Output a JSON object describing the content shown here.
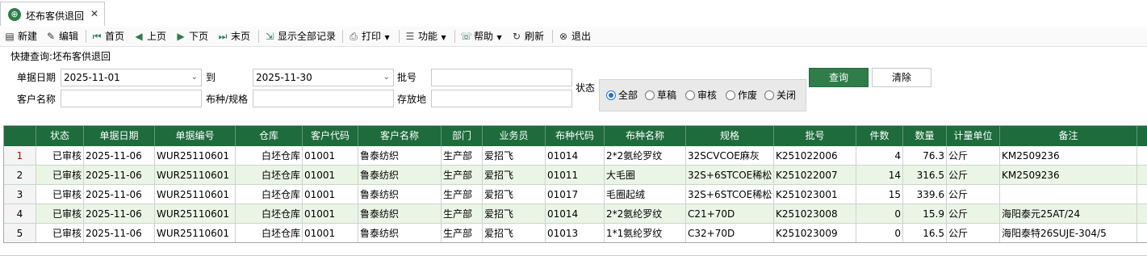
{
  "tab": {
    "title": "坯布客供退回",
    "globe_icon": "globe-icon",
    "close_glyph": "✕"
  },
  "toolbar": {
    "new": "新建",
    "edit": "编辑",
    "first": "首页",
    "prev": "上页",
    "next": "下页",
    "last": "末页",
    "show_all": "显示全部记录",
    "print": "打印",
    "function": "功能",
    "help": "帮助",
    "refresh": "刷新",
    "exit": "退出"
  },
  "quick_query": {
    "label": "快捷查询:坯布客供退回",
    "date_label": "单据日期",
    "date_from": "2025-11-01",
    "to_label": "到",
    "date_to": "2025-11-30",
    "batch_label": "批号",
    "batch_value": "",
    "status_label": "状态",
    "customer_label": "客户名称",
    "customer_value": "",
    "fabric_label": "布种/规格",
    "fabric_value": "",
    "storage_label": "存放地",
    "storage_value": "",
    "status_options": [
      "全部",
      "草稿",
      "审核",
      "作废",
      "关闭"
    ],
    "status_selected": "全部",
    "query_button": "查询",
    "clear_button": "清除"
  },
  "grid": {
    "columns": [
      "状态",
      "单据日期",
      "单据编号",
      "仓库",
      "客户代码",
      "客户名称",
      "部门",
      "业务员",
      "布种代码",
      "布种名称",
      "规格",
      "批号",
      "件数",
      "数量",
      "计量单位",
      "备注"
    ],
    "rows": [
      {
        "no": "1",
        "cells": [
          "已审核",
          "2025-11-06",
          "WUR25110601",
          "白坯仓库",
          "01001",
          "鲁泰纺织",
          "生产部",
          "爱招飞",
          "01014",
          "2*2氨纶罗纹",
          "32SCVCOE麻灰",
          "K251022006",
          "4",
          "76.3",
          "公斤",
          "KM2509236"
        ]
      },
      {
        "no": "2",
        "cells": [
          "已审核",
          "2025-11-06",
          "WUR25110601",
          "白坯仓库",
          "01001",
          "鲁泰纺织",
          "生产部",
          "爱招飞",
          "01011",
          "大毛圈",
          "32S+6STCOE稀松",
          "K251022007",
          "14",
          "316.5",
          "公斤",
          "KM2509236"
        ]
      },
      {
        "no": "3",
        "cells": [
          "已审核",
          "2025-11-06",
          "WUR25110601",
          "白坯仓库",
          "01001",
          "鲁泰纺织",
          "生产部",
          "爱招飞",
          "01017",
          "毛圈起绒",
          "32S+6STCOE稀松",
          "K251023001",
          "15",
          "339.6",
          "公斤",
          ""
        ]
      },
      {
        "no": "4",
        "cells": [
          "已审核",
          "2025-11-06",
          "WUR25110601",
          "白坯仓库",
          "01001",
          "鲁泰纺织",
          "生产部",
          "爱招飞",
          "01014",
          "2*2氨纶罗纹",
          "C21+70D",
          "K251023008",
          "0",
          "15.9",
          "公斤",
          "海阳泰元25AT/24"
        ]
      },
      {
        "no": "5",
        "cells": [
          "已审核",
          "2025-11-06",
          "WUR25110601",
          "白坯仓库",
          "01001",
          "鲁泰纺织",
          "生产部",
          "爱招飞",
          "01013",
          "1*1氨纶罗纹",
          "C32+70D",
          "K251023009",
          "0",
          "16.5",
          "公斤",
          "海阳泰特26SUJE-304/5"
        ]
      }
    ],
    "header_color": "#1e6b3c",
    "alt_row_color": "#eaf5e6"
  }
}
